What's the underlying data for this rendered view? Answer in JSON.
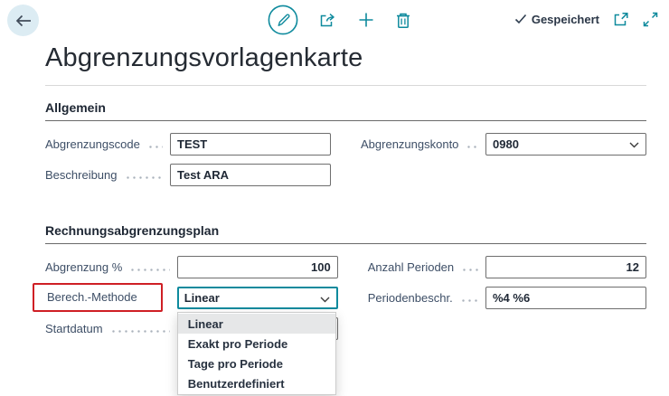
{
  "colors": {
    "accent": "#0e8a9d",
    "annotation": "#cf1f25",
    "label": "#3d4e66"
  },
  "header": {
    "title": "Abgrenzungsvorlagenkarte",
    "saved_status": "Gespeichert",
    "icons": {
      "back": "back-arrow",
      "edit": "pencil-in-circle",
      "share": "share",
      "new": "plus",
      "delete": "trash",
      "saved_check": "check",
      "popout": "pop-out-window",
      "expand": "expand-diagonal"
    }
  },
  "general": {
    "title": "Allgemein",
    "fields": {
      "abgrenzungscode": {
        "label": "Abgrenzungscode",
        "value": "TEST"
      },
      "beschreibung": {
        "label": "Beschreibung",
        "value": "Test ARA"
      },
      "abgrenzungskonto": {
        "label": "Abgrenzungskonto",
        "value": "0980"
      }
    }
  },
  "plan": {
    "title": "Rechnungsabgrenzungsplan",
    "fields": {
      "abgrenzung_prozent": {
        "label": "Abgrenzung %",
        "value": "100"
      },
      "berech_methode": {
        "label": "Berech.-Methode",
        "value": "Linear"
      },
      "startdatum": {
        "label": "Startdatum",
        "value": ""
      },
      "anzahl_perioden": {
        "label": "Anzahl Perioden",
        "value": "12"
      },
      "periodenbeschr": {
        "label": "Periodenbeschr.",
        "value": "%4 %6"
      }
    }
  },
  "methode_dropdown": {
    "selected": "Linear",
    "options": [
      "Linear",
      "Exakt pro Periode",
      "Tage pro Periode",
      "Benutzerdefiniert"
    ]
  }
}
